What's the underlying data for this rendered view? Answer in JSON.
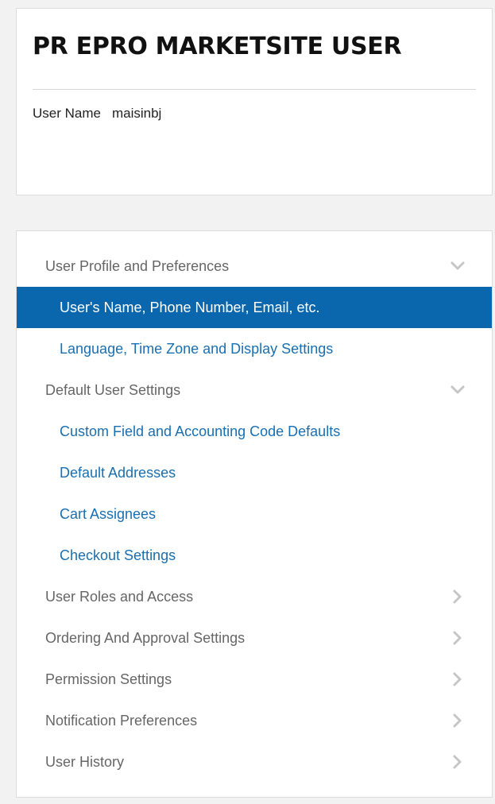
{
  "user": {
    "title": "PR EPRO MARKETSITE USER",
    "field_label": "User Name",
    "field_value": "maisinbj"
  },
  "nav": {
    "items": [
      {
        "label": "User Profile and Preferences",
        "type": "section",
        "icon": "chevron-down-icon"
      },
      {
        "label": "User's Name, Phone Number, Email, etc.",
        "type": "sub",
        "active": true
      },
      {
        "label": "Language, Time Zone and Display Settings",
        "type": "sub"
      },
      {
        "label": "Default User Settings",
        "type": "section",
        "icon": "chevron-down-icon"
      },
      {
        "label": "Custom Field and Accounting Code Defaults",
        "type": "sub"
      },
      {
        "label": "Default Addresses",
        "type": "sub"
      },
      {
        "label": "Cart Assignees",
        "type": "sub"
      },
      {
        "label": "Checkout Settings",
        "type": "sub"
      },
      {
        "label": "User Roles and Access",
        "type": "section",
        "icon": "chevron-right-icon"
      },
      {
        "label": "Ordering And Approval Settings",
        "type": "section",
        "icon": "chevron-right-icon"
      },
      {
        "label": "Permission Settings",
        "type": "section",
        "icon": "chevron-right-icon"
      },
      {
        "label": "Notification Preferences",
        "type": "section",
        "icon": "chevron-right-icon"
      },
      {
        "label": "User History",
        "type": "section",
        "icon": "chevron-right-icon"
      }
    ]
  },
  "colors": {
    "active_background": "#0b67ad",
    "link": "#1a6fb0",
    "section_text": "#666666",
    "icon": "#c6c6c6"
  }
}
